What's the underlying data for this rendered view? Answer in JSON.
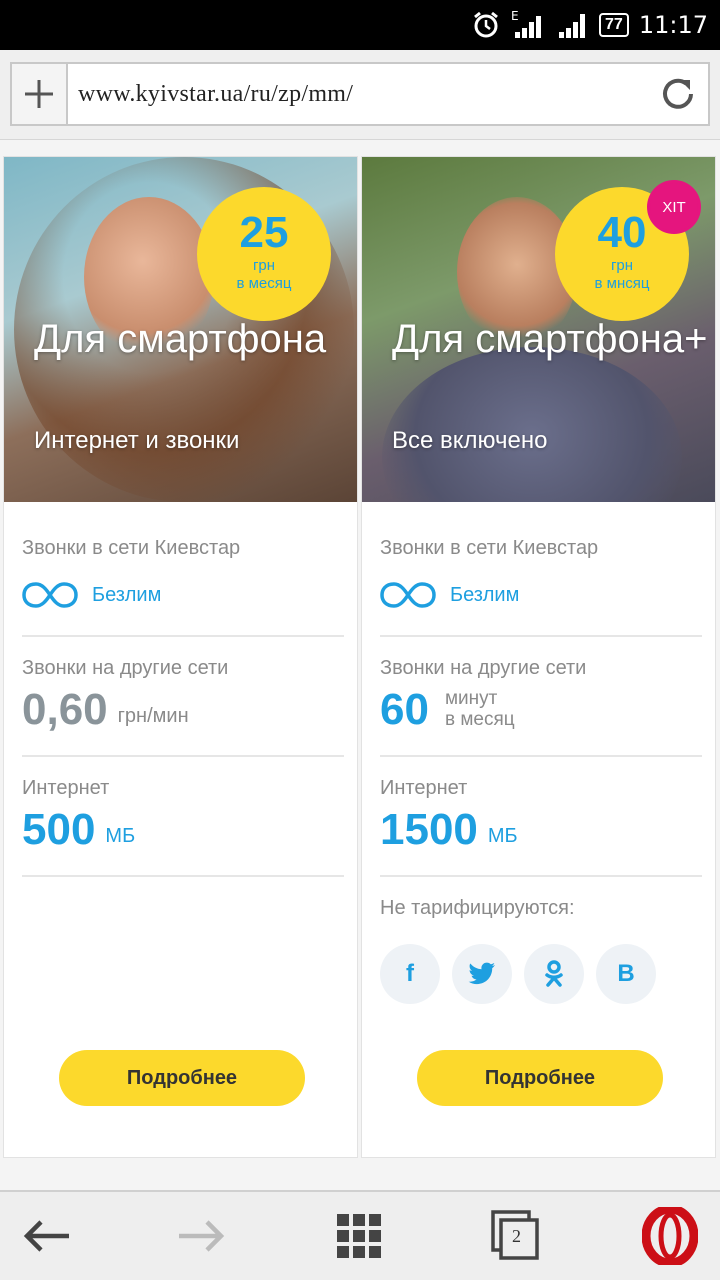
{
  "status_bar": {
    "time": "11:17",
    "battery": "77",
    "network_type": "E",
    "icons": [
      "alarm-icon",
      "signal-icon",
      "signal-icon",
      "battery-icon"
    ]
  },
  "browser": {
    "url": "www.kyivstar.ua/ru/zp/mm/",
    "tab_count": "2"
  },
  "colors": {
    "accent_blue": "#1e9fe0",
    "accent_yellow": "#fcd92c",
    "hit_pink": "#e5157e",
    "opera_red": "#cc0f16"
  },
  "plans": [
    {
      "price": "25",
      "price_unit_1": "грн",
      "price_unit_2": "в месяц",
      "title": "Для смартфона",
      "subtitle": "Интернет и звонки",
      "calls_in_label": "Звонки в сети Киевстар",
      "calls_in_value": "Безлим",
      "calls_other_label": "Звонки на другие сети",
      "calls_other_value": "0,60",
      "calls_other_unit": "грн/мин",
      "internet_label": "Интернет",
      "internet_value": "500",
      "internet_unit": "МБ",
      "button": "Подробнее"
    },
    {
      "price": "40",
      "price_unit_1": "грн",
      "price_unit_2": "в мнсяц",
      "badge": "ХІТ",
      "title": "Для смартфона+",
      "subtitle": "Все включено",
      "calls_in_label": "Звонки в сети Киевстар",
      "calls_in_value": "Безлим",
      "calls_other_label": "Звонки на другие сети",
      "calls_other_value": "60",
      "calls_other_unit_1": "минут",
      "calls_other_unit_2": "в месяц",
      "internet_label": "Интернет",
      "internet_value": "1500",
      "internet_unit": "МБ",
      "not_charged_label": "Не тарифицируются:",
      "social": [
        "f",
        "twitter",
        "ok",
        "B"
      ],
      "button": "Подробнее"
    }
  ]
}
